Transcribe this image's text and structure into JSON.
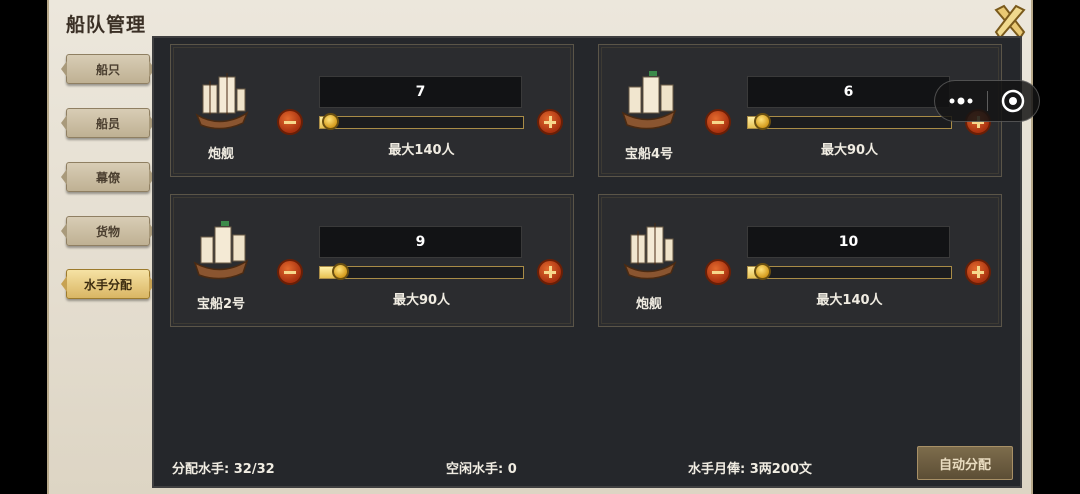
{
  "window": {
    "title": "船队管理"
  },
  "sidebar": {
    "tabs": [
      {
        "label": "船只",
        "active": false
      },
      {
        "label": "船员",
        "active": false
      },
      {
        "label": "幕僚",
        "active": false
      },
      {
        "label": "货物",
        "active": false
      },
      {
        "label": "水手分配",
        "active": true
      }
    ]
  },
  "ships": [
    {
      "name": "炮舰",
      "count": "7",
      "max": "最大140人",
      "slider_fraction": 0.05
    },
    {
      "name": "宝船4号",
      "count": "6",
      "max": "最大90人",
      "slider_fraction": 0.07
    },
    {
      "name": "宝船2号",
      "count": "9",
      "max": "最大90人",
      "slider_fraction": 0.1
    },
    {
      "name": "炮舰",
      "count": "10",
      "max": "最大140人",
      "slider_fraction": 0.07
    }
  ],
  "footer": {
    "assigned": "分配水手: 32/32",
    "idle": "空闲水手: 0",
    "salary": "水手月俸: 3两200文",
    "auto_button": "自动分配"
  },
  "colors": {
    "accent_gold": "#e6c153",
    "button_red": "#c2461a",
    "panel_dark": "#25272b"
  }
}
